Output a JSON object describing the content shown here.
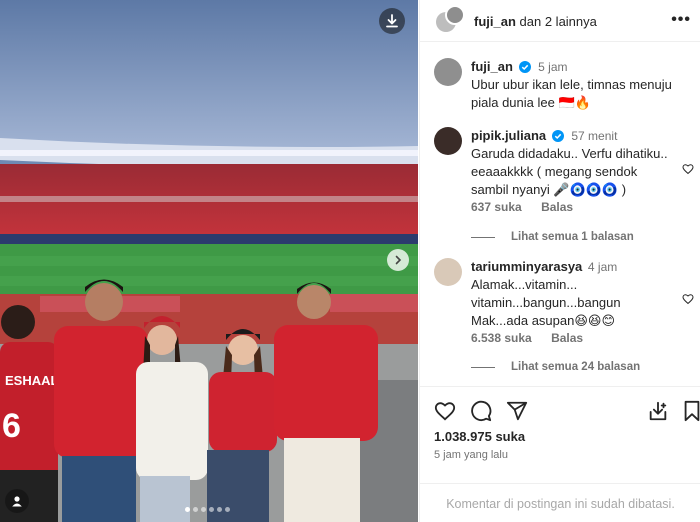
{
  "post": {
    "owner": "fuji_an",
    "owner_suffix": "dan 2 lainnya",
    "more_label": "•••"
  },
  "comments": [
    {
      "user": "fuji_an",
      "verified": true,
      "time": "5 jam",
      "text": "Ubur ubur ikan lele, timnas menuju piala dunia lee 🇮🇩🔥"
    },
    {
      "user": "pipik.juliana",
      "verified": true,
      "time": "57 menit",
      "text": "Garuda didadaku.. Verfu dihatiku.. eeaaakkkk ( megang sendok sambil nyanyi 🎤🧿🧿🧿 )",
      "likes": "637 suka",
      "reply": "Balas",
      "view_replies": "Lihat semua 1 balasan"
    },
    {
      "user": "tariumminyarasya",
      "verified": false,
      "time": "4 jam",
      "text": "Alamak...vitamin... vitamin...bangun...bangun Mak...ada asupan😆😆😊",
      "likes": "6.538 suka",
      "reply": "Balas",
      "view_replies": "Lihat semua 24 balasan"
    }
  ],
  "stats": {
    "likes": "1.038.975 suka",
    "posted_ago": "5 jam yang lalu"
  },
  "footer": {
    "comments_disabled": "Komentar di postingan ini sudah dibatasi."
  },
  "photo": {
    "jersey_name": "ESHAAL",
    "jersey_number": "6",
    "carousel_count": 6,
    "carousel_active": 1
  },
  "icons": {
    "download": "download-icon",
    "next": "chevron-right-icon",
    "tag": "user-tag-icon",
    "like": "heart-icon",
    "comment": "comment-icon",
    "share": "paper-plane-icon",
    "save": "bookmark-icon",
    "save_to": "save-to-icon"
  },
  "colors": {
    "verified": "#0095f6",
    "text": "#262626",
    "muted": "#737373"
  }
}
